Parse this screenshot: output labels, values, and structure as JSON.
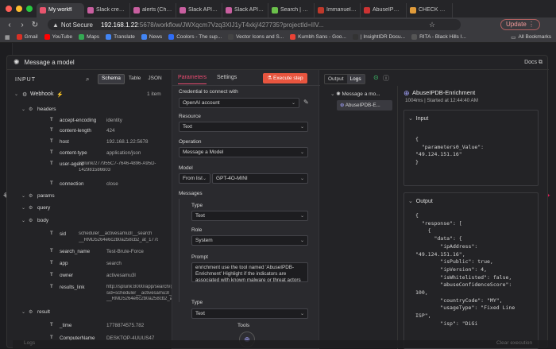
{
  "browser": {
    "tabs": [
      {
        "label": "My workfl",
        "color": "#e8556e",
        "active": true
      },
      {
        "label": "Slack credential",
        "color": "#c95fa0"
      },
      {
        "label": "alerts (Channel)",
        "color": "#c95fa0"
      },
      {
        "label": "Slack API: Appli",
        "color": "#c95fa0"
      },
      {
        "label": "Slack API: Appli",
        "color": "#c95fa0"
      },
      {
        "label": "Search | Splunk",
        "color": "#6bc04b"
      },
      {
        "label": "Immanuel Samu",
        "color": "#c0392b"
      },
      {
        "label": "AbuseIPDB - IP",
        "color": "#cc3333"
      },
      {
        "label": "CHECK Endpoint",
        "color": "#e09b3a"
      }
    ],
    "security": "Not Secure",
    "url_host": "192.168.1.22",
    "url_rest": ":5678/workflow/JWXqcm7Vzq3XIJ1yT4xkj/427735?projectId=IIV...",
    "update_label": "Update",
    "bookmarks": [
      {
        "label": "Gmail",
        "color": "#d93025"
      },
      {
        "label": "YouTube",
        "color": "#ff0000"
      },
      {
        "label": "Maps",
        "color": "#34a853"
      },
      {
        "label": "Translate",
        "color": "#4285f4"
      },
      {
        "label": "News",
        "color": "#4285f4"
      },
      {
        "label": "Coolors - The sup...",
        "color": "#2f6df6"
      },
      {
        "label": "Vector Icons and S...",
        "color": "#444"
      },
      {
        "label": "Kumbh Sans - Goo...",
        "color": "#e94235"
      },
      {
        "label": "| InsightIDR Docu...",
        "color": "#333"
      },
      {
        "label": "RITA - Black Hills I...",
        "color": "#555"
      }
    ],
    "all_bookmarks": "All Bookmarks"
  },
  "modal": {
    "title": "Message a model",
    "docs": "Docs"
  },
  "input": {
    "heading": "INPUT",
    "views": [
      "Schema",
      "Table",
      "JSON"
    ],
    "webhook": "Webhook",
    "item_count": "1 item",
    "rows": [
      {
        "key": "headers",
        "type": "group"
      },
      {
        "key": "accept-encoding",
        "value": "identity"
      },
      {
        "key": "content-length",
        "value": "424"
      },
      {
        "key": "host",
        "value": "192.168.1.22:5678"
      },
      {
        "key": "content-type",
        "value": "application/json"
      },
      {
        "key": "user-agent",
        "value1": "Splunk/277955C7-7646-4896-A95D-",
        "value2": "142981586603"
      },
      {
        "key": "connection",
        "value": "close"
      },
      {
        "key": "params",
        "type": "group"
      },
      {
        "key": "query",
        "type": "group"
      },
      {
        "key": "body",
        "type": "group"
      },
      {
        "key": "sid",
        "value1": "scheduler__activesamu3l__search",
        "value2": "__RMD5264e6c2b0a258cb2_at_1778879400_19"
      },
      {
        "key": "search_name",
        "value": "Test-Brute-Force"
      },
      {
        "key": "app",
        "value": "search"
      },
      {
        "key": "owner",
        "value": "activesamu3l"
      },
      {
        "key": "results_link",
        "value1": "http://splunk:8000/app/search/@go?",
        "value2": "sid=scheduler__activesamu3l__search",
        "value3": "__RMD5264e6c2b0a258cb2_at_1778879400_19"
      },
      {
        "key": "result",
        "type": "group"
      },
      {
        "key": "_time",
        "value": "1778874575.782"
      },
      {
        "key": "ComputerName",
        "value": "DESKTOP-4UUUS47"
      }
    ]
  },
  "params": {
    "tabs": [
      "Parameters",
      "Settings"
    ],
    "execute": "Execute step",
    "credential_label": "Credential to connect with",
    "credential_value": "OpenAI account",
    "resource_label": "Resource",
    "resource_value": "Text",
    "operation_label": "Operation",
    "operation_value": "Message a Model",
    "model_label": "Model",
    "model_mode": "From list",
    "model_value": "GPT-4O-MINI",
    "messages_label": "Messages",
    "type_label": "Type",
    "type_value": "Text",
    "role_label": "Role",
    "role_value": "System",
    "prompt_label": "Prompt",
    "prompt_text": "enrichment use the tool named 'AbuseIPDB-Enrichment' Highlight if the indicators are associated with known malware or threat actors",
    "type2_label": "Type",
    "type2_value": "Text",
    "tools_label": "Tools"
  },
  "output": {
    "tabs": [
      "Output",
      "Logs"
    ],
    "tree_root": "Message a mo...",
    "tree_child": "AbuseIPDB-E...",
    "title": "AbuseIPDB-Enrichment",
    "meta": "1004ms | Started at 12:44:40 AM",
    "input_heading": "Input",
    "input_json": "{\n  \"parameters0_Value\":\n\"49.124.151.16\"\n}",
    "output_heading": "Output",
    "output_json": "{\n  \"response\": [\n    {\n      \"data\": {\n        \"ipAddress\":\n\"49.124.151.16\",\n        \"isPublic\": true,\n        \"ipVersion\": 4,\n        \"isWhitelisted\": false,\n        \"abuseConfidenceScore\":\n100,\n        \"countryCode\": \"MY\",\n        \"usageType\": \"Fixed Line\nISP\",\n        \"isp\": \"DiGi"
  },
  "footer": {
    "logs": "Logs",
    "clear": "Clear execution"
  },
  "colors": {
    "accent": "#ea4b71",
    "execute_bg": "#e8553f",
    "selected_row": "#3a3a40"
  }
}
